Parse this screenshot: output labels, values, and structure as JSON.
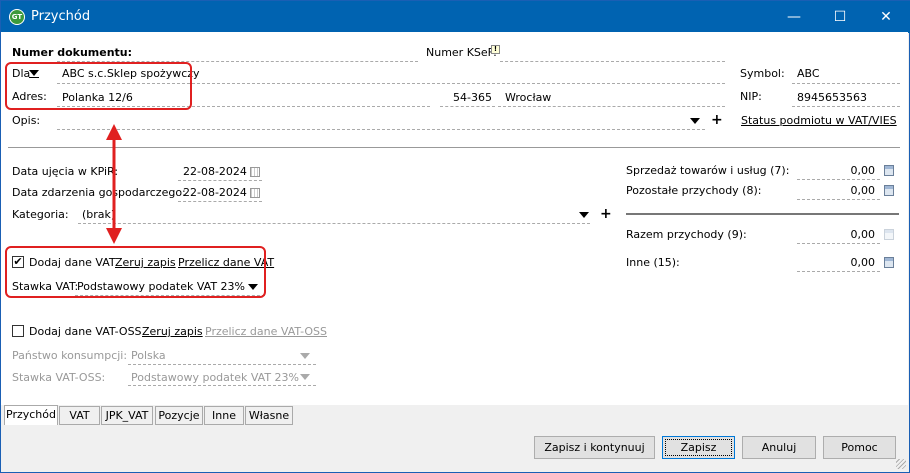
{
  "window": {
    "title": "Przychód",
    "logo_text": "GT",
    "minimize": "—",
    "maximize": "☐",
    "close": "✕"
  },
  "header": {
    "numer_dokumentu_label": "Numer dokumentu:",
    "numer_dokumentu_value": "",
    "numer_ksef_label": "Numer KSeF:",
    "numer_ksef_icon": "!",
    "dla_label": "Dla",
    "dla_value": "ABC s.c.Sklep spożywczy",
    "symbol_label": "Symbol:",
    "symbol_value": "ABC",
    "adres_label": "Adres:",
    "adres_value": "Polanka 12/6",
    "kod": "54-365",
    "miasto": "Wrocław",
    "nip_label": "NIP:",
    "nip_value": "8945653563",
    "opis_label": "Opis:",
    "opis_value": "",
    "status_link": "Status podmiotu w VAT/VIES"
  },
  "dates": {
    "data_ujecia_label": "Data ujęcia w KPiR:",
    "data_ujecia_value": "22-08-2024",
    "data_zdarzenia_label": "Data zdarzenia gospodarczego:",
    "data_zdarzenia_value": "22-08-2024",
    "kategoria_label": "Kategoria:",
    "kategoria_value": "(brak)"
  },
  "amounts": [
    {
      "label": "Sprzedaż towarów i usług (7):",
      "value": "0,00"
    },
    {
      "label": "Pozostałe przychody (8):",
      "value": "0,00"
    },
    {
      "label": "Razem przychody (9):",
      "value": "0,00"
    },
    {
      "label": "Inne (15):",
      "value": "0,00"
    }
  ],
  "vat": {
    "checked": true,
    "label": "Dodaj dane VAT",
    "zeruj": "Zeruj zapis",
    "przelicz": "Przelicz dane VAT",
    "stawka_label": "Stawka VAT:",
    "stawka_value": "Podstawowy podatek VAT 23%"
  },
  "vat_oss": {
    "checked": false,
    "label": "Dodaj dane VAT-OSS",
    "zeruj": "Zeruj zapis",
    "przelicz": "Przelicz dane VAT-OSS",
    "panstwo_label": "Państwo konsumpcji:",
    "panstwo_value": "Polska",
    "stawka_label": "Stawka VAT-OSS:",
    "stawka_value": "Podstawowy podatek VAT 23%"
  },
  "tabs": [
    "Przychód",
    "VAT",
    "JPK_VAT",
    "Pozycje",
    "Inne",
    "Własne"
  ],
  "active_tab": "Przychód",
  "buttons": {
    "save_continue": "Zapisz i kontynuuj",
    "save": "Zapisz",
    "cancel": "Anuluj",
    "help": "Pomoc"
  },
  "colors": {
    "titlebar": "#0063b1",
    "highlight": "#e02020"
  }
}
